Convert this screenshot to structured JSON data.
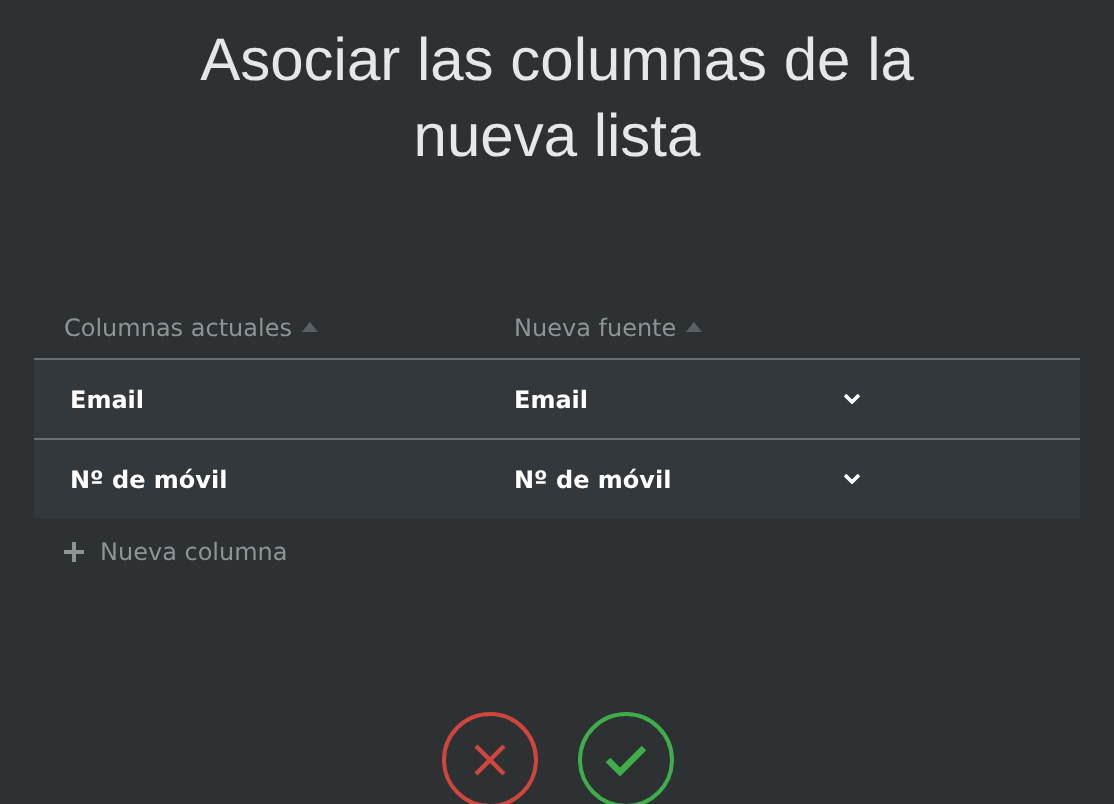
{
  "title": "Asociar las columnas de la nueva lista",
  "table": {
    "columns": [
      {
        "label": "Columnas actuales"
      },
      {
        "label": "Nueva fuente"
      }
    ],
    "rows": [
      {
        "current": "Email",
        "source": "Email"
      },
      {
        "current": "Nº de móvil",
        "source": "Nº de móvil"
      }
    ]
  },
  "add_column": {
    "label": "Nueva columna"
  },
  "actions": [
    {
      "kind": "cancel"
    },
    {
      "kind": "confirm"
    }
  ]
}
